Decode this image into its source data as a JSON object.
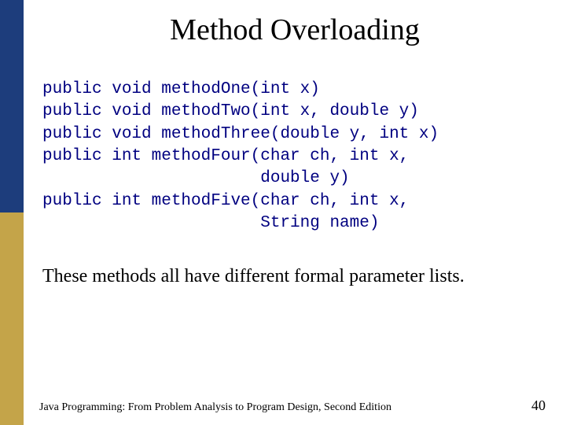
{
  "title": "Method Overloading",
  "code": "public void methodOne(int x)\npublic void methodTwo(int x, double y)\npublic void methodThree(double y, int x)\npublic int methodFour(char ch, int x,\n                      double y)\npublic int methodFive(char ch, int x,\n                      String name)",
  "body": "These methods all have different formal parameter lists.",
  "footer": {
    "text": "Java Programming: From Problem Analysis to Program Design, Second Edition",
    "page": "40"
  }
}
